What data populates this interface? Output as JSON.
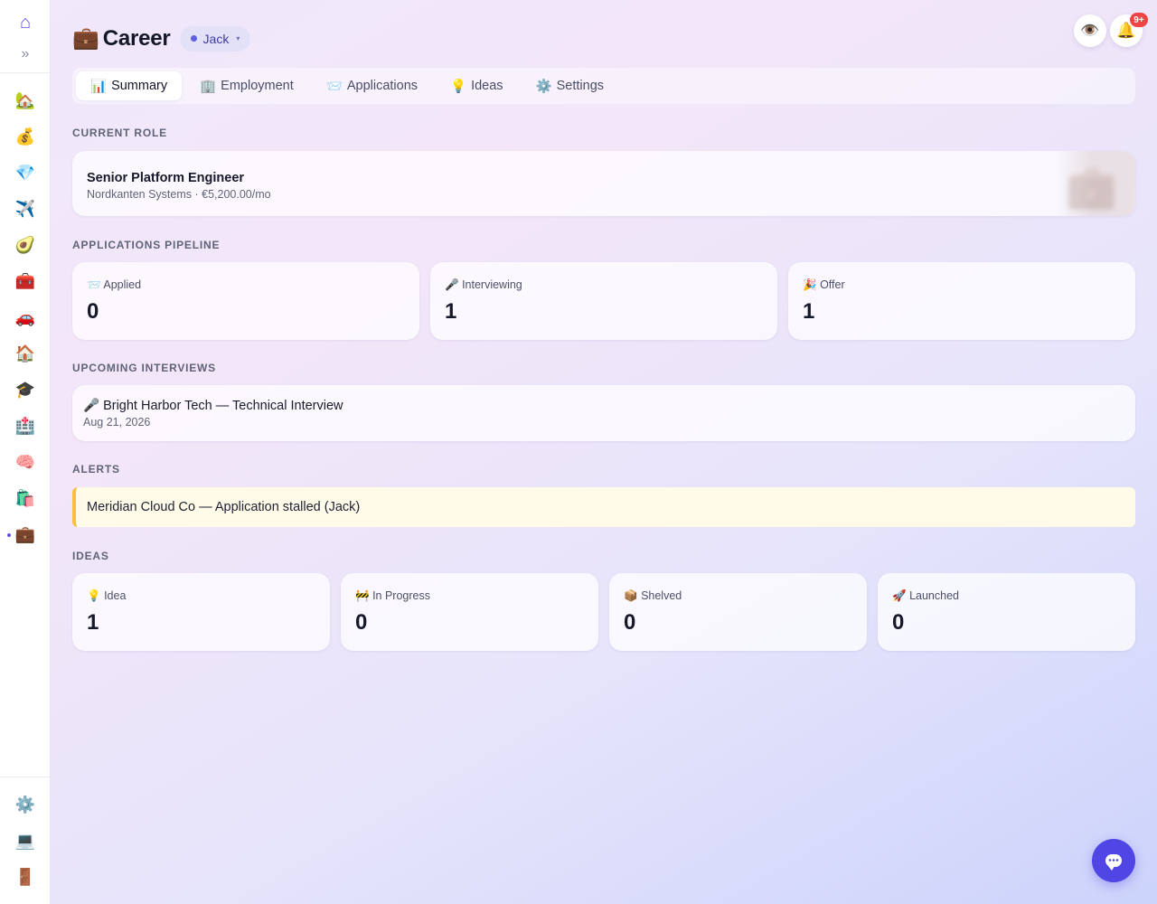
{
  "sidebar": {
    "logo_icon": "⌂",
    "expand_icon": "»",
    "items": [
      {
        "icon": "🏡",
        "name": "home"
      },
      {
        "icon": "💰",
        "name": "finance"
      },
      {
        "icon": "💎",
        "name": "assets"
      },
      {
        "icon": "✈️",
        "name": "travel"
      },
      {
        "icon": "🥑",
        "name": "food"
      },
      {
        "icon": "🧰",
        "name": "tools"
      },
      {
        "icon": "🚗",
        "name": "vehicles"
      },
      {
        "icon": "🏠",
        "name": "property"
      },
      {
        "icon": "🎓",
        "name": "education"
      },
      {
        "icon": "🏥",
        "name": "health"
      },
      {
        "icon": "🧠",
        "name": "mind"
      },
      {
        "icon": "🛍️",
        "name": "shopping"
      },
      {
        "icon": "💼",
        "name": "career"
      }
    ],
    "bottom": [
      {
        "icon": "⚙️",
        "name": "settings"
      },
      {
        "icon": "💻",
        "name": "device"
      },
      {
        "icon": "🚪",
        "name": "logout"
      }
    ]
  },
  "header": {
    "icon": "💼",
    "title": "Career",
    "user": "Jack",
    "caret": "▾",
    "eye_icon": "👁️",
    "bell_icon": "🔔",
    "notif_count": "9+"
  },
  "tabs": [
    {
      "icon": "📊",
      "label": "Summary",
      "active": true
    },
    {
      "icon": "🏢",
      "label": "Employment",
      "active": false
    },
    {
      "icon": "📨",
      "label": "Applications",
      "active": false
    },
    {
      "icon": "💡",
      "label": "Ideas",
      "active": false
    },
    {
      "icon": "⚙️",
      "label": "Settings",
      "active": false
    }
  ],
  "current_role": {
    "section": "CURRENT ROLE",
    "title": "Senior Platform Engineer",
    "subtitle": "Nordkanten Systems · €5,200.00/mo"
  },
  "pipeline": {
    "section": "APPLICATIONS PIPELINE",
    "stats": [
      {
        "icon": "📨",
        "label": "Applied",
        "value": "0"
      },
      {
        "icon": "🎤",
        "label": "Interviewing",
        "value": "1"
      },
      {
        "icon": "🎉",
        "label": "Offer",
        "value": "1"
      }
    ]
  },
  "interviews": {
    "section": "UPCOMING INTERVIEWS",
    "items": [
      {
        "title": "🎤 Bright Harbor Tech — Technical Interview",
        "date": "Aug 21, 2026"
      }
    ]
  },
  "alerts": {
    "section": "ALERTS",
    "items": [
      {
        "text": "Meridian Cloud Co — Application stalled (Jack)",
        "color": "#f4c03d"
      }
    ]
  },
  "ideas": {
    "section": "IDEAS",
    "stats": [
      {
        "icon": "💡",
        "label": "Idea",
        "value": "1"
      },
      {
        "icon": "🚧",
        "label": "In Progress",
        "value": "0"
      },
      {
        "icon": "📦",
        "label": "Shelved",
        "value": "0"
      },
      {
        "icon": "🚀",
        "label": "Launched",
        "value": "0"
      }
    ]
  },
  "colors": {
    "accent": "#4f46e5",
    "alert_border": "#f4c03d",
    "badge": "#ef4444"
  }
}
